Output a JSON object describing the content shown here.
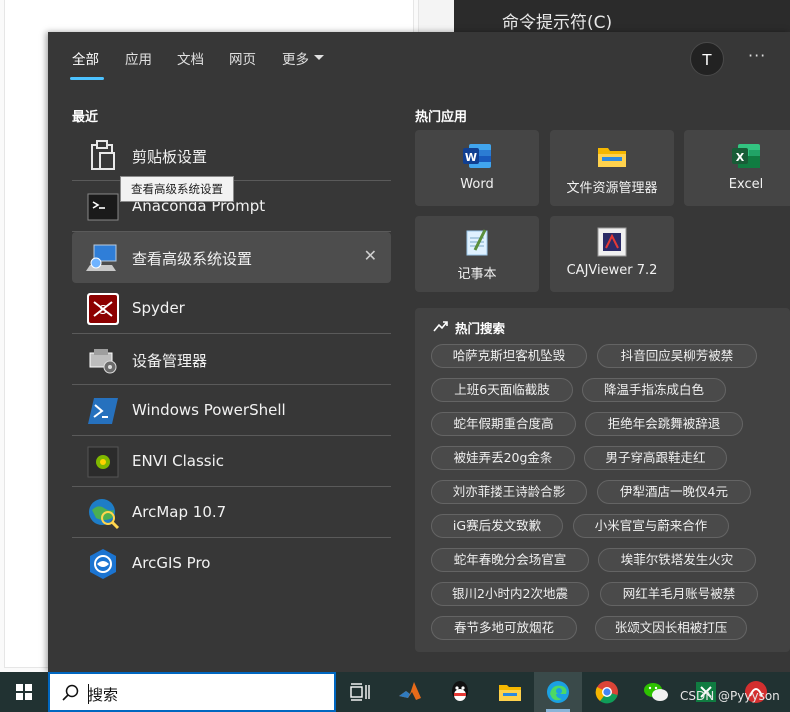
{
  "background": {
    "right_panel_title": "命令提示符(C)"
  },
  "tabs": [
    {
      "label": "全部",
      "active": true
    },
    {
      "label": "应用"
    },
    {
      "label": "文档"
    },
    {
      "label": "网页"
    },
    {
      "label": "更多"
    }
  ],
  "account": {
    "initial": "T",
    "more": "···"
  },
  "recent": {
    "title": "最近",
    "items": [
      {
        "label": "剪贴板设置",
        "icon": "clipboard-icon"
      },
      {
        "label": "Anaconda Prompt",
        "icon": "terminal-icon"
      },
      {
        "label": "查看高级系统设置",
        "icon": "computer-settings-icon",
        "hovered": true,
        "remove": "✕"
      },
      {
        "label": "Spyder",
        "icon": "spyder-icon"
      },
      {
        "label": "设备管理器",
        "icon": "device-manager-icon"
      },
      {
        "label": "Windows PowerShell",
        "icon": "powershell-icon"
      },
      {
        "label": "ENVI Classic",
        "icon": "envi-icon"
      },
      {
        "label": "ArcMap 10.7",
        "icon": "arcmap-icon"
      },
      {
        "label": "ArcGIS Pro",
        "icon": "arcgis-pro-icon"
      }
    ],
    "tooltip": "查看高级系统设置"
  },
  "top_apps": {
    "title": "热门应用",
    "items": [
      {
        "label": "Word",
        "icon": "word-icon"
      },
      {
        "label": "文件资源管理器",
        "icon": "file-explorer-icon"
      },
      {
        "label": "Excel",
        "icon": "excel-icon"
      },
      {
        "label": "记事本",
        "icon": "notepad-icon"
      },
      {
        "label": "CAJViewer 7.2",
        "icon": "cajviewer-icon"
      }
    ]
  },
  "hot_searches": {
    "title": "热门搜索",
    "items": [
      "哈萨克斯坦客机坠毁",
      "抖音回应吴柳芳被禁",
      "上班6天面临截肢",
      "降温手指冻成白色",
      "蛇年假期重合度高",
      "拒绝年会跳舞被辞退",
      "被娃弄丢20g金条",
      "男子穿高跟鞋走红",
      "刘亦菲搂王诗龄合影",
      "伊犁酒店一晚仅4元",
      "iG赛后发文致歉",
      "小米官宣与蔚来合作",
      "蛇年春晚分会场官宣",
      "埃菲尔铁塔发生火灾",
      "银川2小时内2次地震",
      "网红羊毛月账号被禁",
      "春节多地可放烟花",
      "张颂文因长相被打压"
    ]
  },
  "taskbar": {
    "search_value": "搜索",
    "watermark": "CSDN @Pyyyson"
  },
  "colors": {
    "flyout_bg": "#373737",
    "accent": "#4cc2ff",
    "taskbar_bg": "#213232"
  }
}
